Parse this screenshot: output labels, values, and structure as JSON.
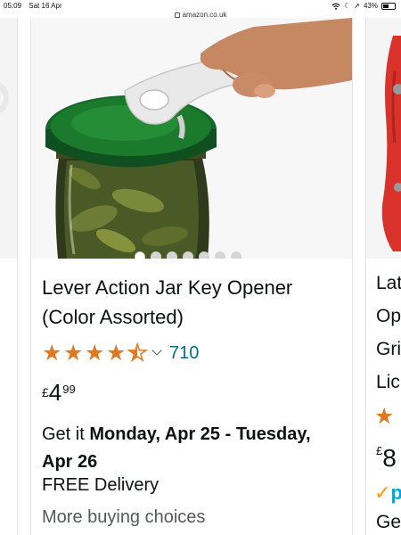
{
  "status_bar": {
    "time": "05:09",
    "date": "Sat 16 Apr",
    "url": "amazon.co.uk",
    "battery": "43%"
  },
  "product": {
    "title": "Lever Action Jar Key Opener (Color Assorted)",
    "rating": 4.5,
    "review_count": "710",
    "price_symbol": "£",
    "price_whole": "4",
    "price_fraction": "99",
    "delivery_prefix": "Get it ",
    "delivery_dates": "Monday, Apr 25 - Tuesday, Apr 26",
    "free_delivery": "FREE Delivery",
    "more_buying": "More buying choices",
    "image_dots_total": 7,
    "image_dots_active": 1
  },
  "next_product": {
    "title_lines": [
      "Lat",
      "Op",
      "Gri",
      "Lic"
    ],
    "price_symbol": "£",
    "price_whole": "8",
    "prime_label": "p",
    "delivery_prefix": "Get"
  },
  "colors": {
    "star": "#de7921",
    "link": "#007185",
    "lid": "#1b7a2c",
    "opener": "#e9e9e9",
    "next_product_red": "#d8322b"
  },
  "icons": [
    "lock-icon",
    "wifi-icon",
    "moon-icon",
    "location-icon",
    "battery-icon",
    "star-icon",
    "chevron-down-icon",
    "prime-check-icon"
  ]
}
